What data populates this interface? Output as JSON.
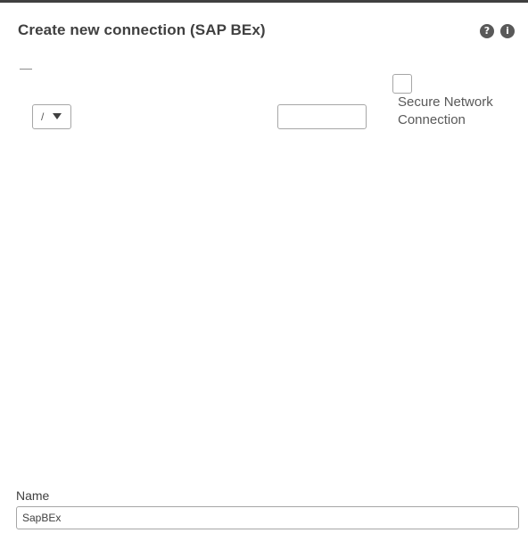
{
  "dialog": {
    "title": "Create new connection (SAP BEx)",
    "help_icon": "question-circle-icon",
    "info_icon": "info-circle-icon"
  },
  "connection": {
    "select_value": "/",
    "text_input_value": "",
    "secure_network_label": "Secure Network Connection",
    "secure_network_checked": false
  },
  "name_field": {
    "label": "Name",
    "value": "SapBEx"
  },
  "colors": {
    "text": "#404040",
    "border": "#a6a6a6",
    "icon_bg": "#595959"
  }
}
